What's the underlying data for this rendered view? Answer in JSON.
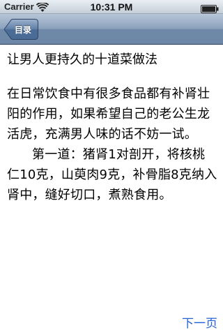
{
  "status_bar": {
    "carrier": "Carrier",
    "time": "10:31 PM",
    "wifi_icon": "wifi-icon",
    "battery_icon": "battery-icon"
  },
  "nav_bar": {
    "back_label": "目录",
    "back_icon": "back-chevron-button"
  },
  "article": {
    "title": "让男人更持久的十道菜做法",
    "paragraphs": [
      "在日常饮食中有很多食品都有补肾壮阳的作用，如果希望自己的老公生龙活虎，充满男人味的话不妨一试。",
      "第一道：猪肾1对剖开，将核桃仁10克，山萸肉9克，补骨脂8克纳入肾中，缝好切口，煮熟食用。"
    ]
  },
  "footer": {
    "next_label": "下一页"
  },
  "colors": {
    "nav_bar": "#6d87a8",
    "link": "#2461d6"
  }
}
